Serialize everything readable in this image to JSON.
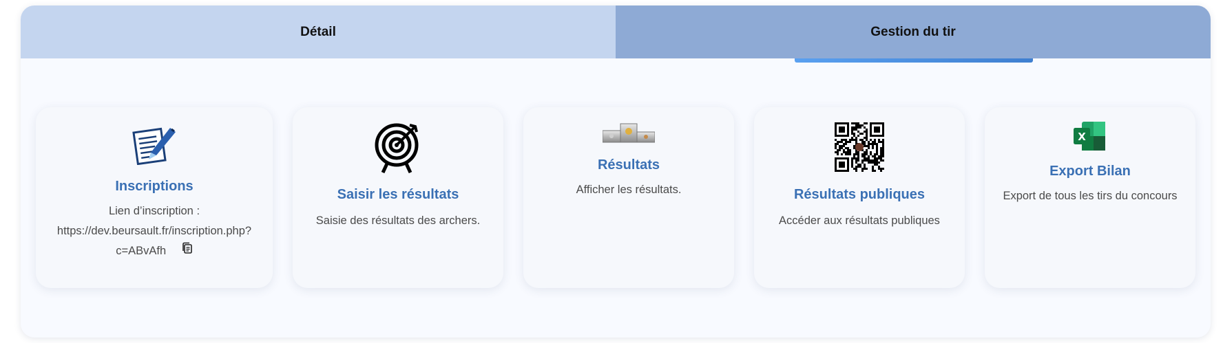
{
  "tabs": [
    {
      "label": "Détail"
    },
    {
      "label": "Gestion du tir"
    }
  ],
  "cards": {
    "inscriptions": {
      "icon": "signing-document-icon",
      "title": "Inscriptions",
      "desc_label": "Lien d’inscription :",
      "desc_url": "https://dev.beursault.fr/inscription.php?c=ABvAfh",
      "desc_url_line1": "https://dev.beursault.fr/inscription.php?",
      "desc_url_line2": "c=ABvAfh"
    },
    "saisir": {
      "icon": "target-icon",
      "title": "Saisir les résultats",
      "desc": "Saisie des résultats des archers."
    },
    "resultats": {
      "icon": "podium-icon",
      "title": "Résultats",
      "desc": "Afficher les résultats."
    },
    "publiques": {
      "icon": "qr-code-icon",
      "title": "Résultats publiques",
      "desc": "Accéder aux résultats publiques"
    },
    "export": {
      "icon": "excel-icon",
      "title": "Export Bilan",
      "desc": "Export de tous les tirs du concours"
    }
  },
  "colors": {
    "tab_inactive": "#c4d5ef",
    "tab_active": "#8eaad5",
    "accent": "#3a70b4",
    "excel_green": "#107c41"
  }
}
